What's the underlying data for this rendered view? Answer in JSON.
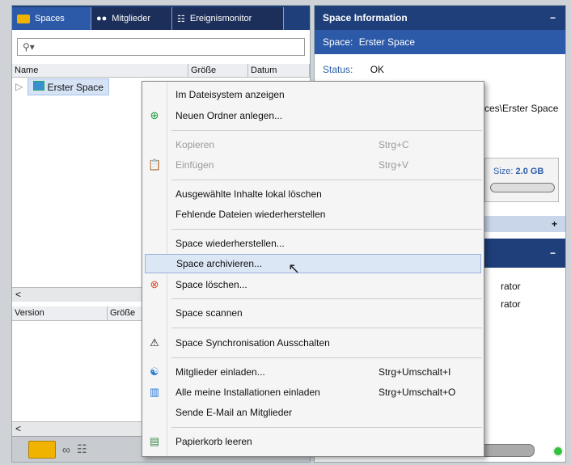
{
  "left": {
    "tabs": [
      {
        "label": "Spaces"
      },
      {
        "label": "Mitglieder"
      },
      {
        "label": "Ereignismonitor"
      }
    ],
    "search_icon": "search-icon",
    "columns": [
      "Name",
      "Größe",
      "Datum"
    ],
    "tree": [
      {
        "label": "Erster Space"
      }
    ],
    "columns2": [
      "Version",
      "Größe"
    ]
  },
  "right": {
    "title": "Space Information",
    "space_label": "Space:",
    "space_value": "Erster Space",
    "status_label": "Status:",
    "status_value": "OK",
    "path_tail": "ces\\Erster Space",
    "size_label": "Size:",
    "size_value": "2.0 GB",
    "plus": "+",
    "minus": "−",
    "admin1": "rator",
    "admin2": "rator"
  },
  "menu": {
    "items": [
      {
        "label": "Im Dateisystem anzeigen",
        "shortcut": "",
        "disabled": false
      },
      {
        "label": "Neuen Ordner anlegen...",
        "shortcut": "",
        "disabled": false
      },
      {
        "label": "Kopieren",
        "shortcut": "Strg+C",
        "disabled": true
      },
      {
        "label": "Einfügen",
        "shortcut": "Strg+V",
        "disabled": true
      },
      {
        "label": "Ausgewählte Inhalte lokal löschen",
        "shortcut": "",
        "disabled": false
      },
      {
        "label": "Fehlende Dateien wiederherstellen",
        "shortcut": "",
        "disabled": false
      },
      {
        "label": "Space wiederherstellen...",
        "shortcut": "",
        "disabled": false
      },
      {
        "label": "Space archivieren...",
        "shortcut": "",
        "disabled": false,
        "highlighted": true
      },
      {
        "label": "Space löschen...",
        "shortcut": "",
        "disabled": false
      },
      {
        "label": "Space scannen",
        "shortcut": "",
        "disabled": false
      },
      {
        "label": "Space Synchronisation Ausschalten",
        "shortcut": "",
        "disabled": false
      },
      {
        "label": "Mitglieder einladen...",
        "shortcut": "Strg+Umschalt+I",
        "disabled": false
      },
      {
        "label": "Alle meine Installationen einladen",
        "shortcut": "Strg+Umschalt+O",
        "disabled": false
      },
      {
        "label": "Sende E-Mail an Mitglieder",
        "shortcut": "",
        "disabled": false
      },
      {
        "label": "Papierkorb leeren",
        "shortcut": "",
        "disabled": false
      }
    ]
  },
  "colors": {
    "header": "#1f3f7a",
    "accent": "#2c5aa8",
    "highlight": "#dce7f5"
  }
}
